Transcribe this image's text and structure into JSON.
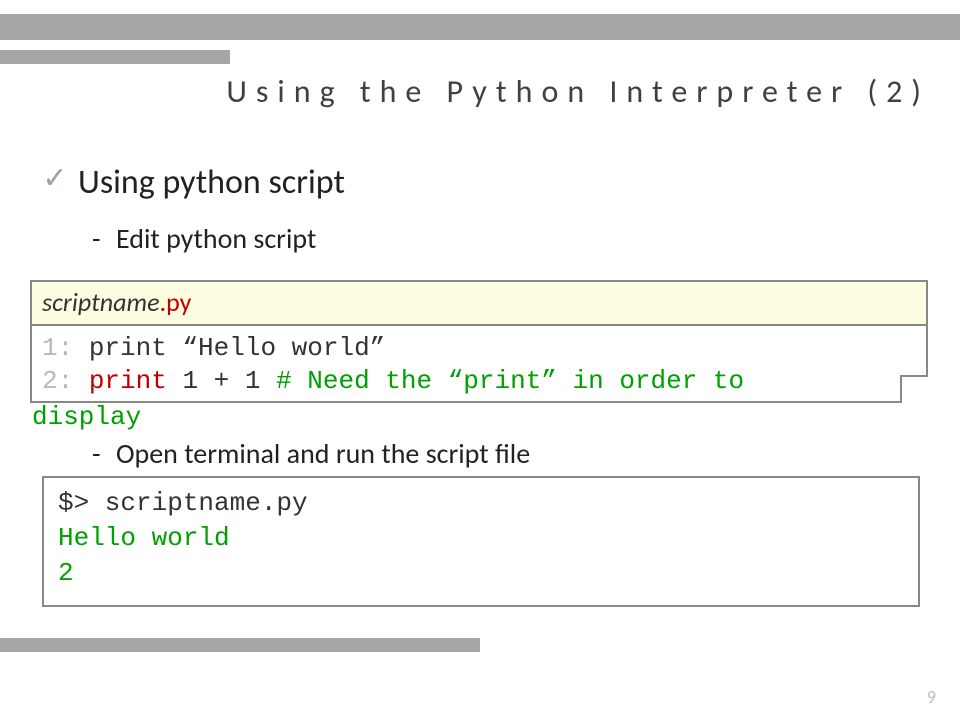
{
  "title": "Using the Python Interpreter (2)",
  "bullet": {
    "label": "Using python script"
  },
  "sub1": "Edit python script",
  "file": {
    "stem": "scriptname",
    "ext": ".py"
  },
  "code": {
    "l1": {
      "num": "1:",
      "body": " print “Hello world”"
    },
    "l2": {
      "num": "2:",
      "kw": " print",
      "rest": " 1 + 1  ",
      "comment": "# Need the “print” in order to"
    },
    "wrap": "display"
  },
  "sub2": "Open terminal and run the script file",
  "term": {
    "cmd": "$> scriptname.py",
    "out1": "Hello world",
    "out2": "2"
  },
  "pagenum": "9"
}
